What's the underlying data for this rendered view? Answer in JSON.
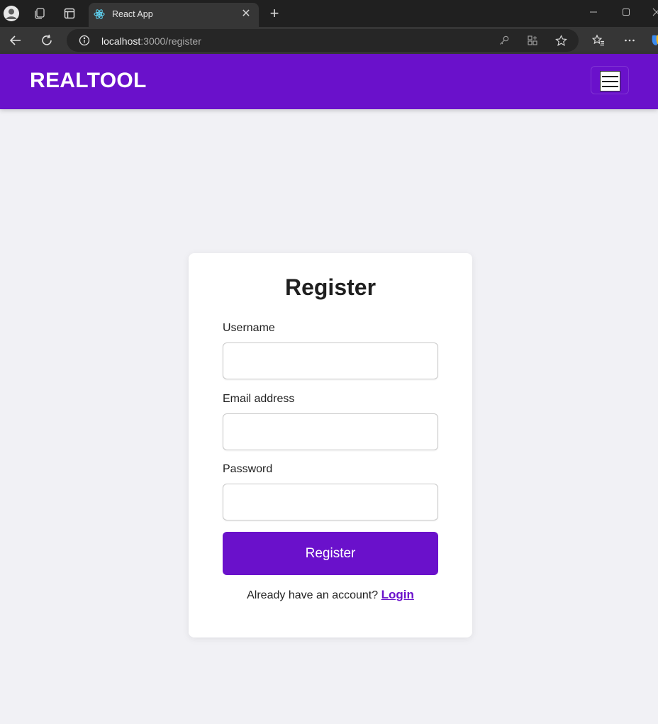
{
  "browser": {
    "tab_title": "React App",
    "tab_close_glyph": "✕",
    "new_tab_glyph": "+",
    "url_host": "localhost",
    "url_path": ":3000/register",
    "icons": [
      "profile-icon",
      "workspaces-icon",
      "tab-actions-icon",
      "react-favicon",
      "back-icon",
      "refresh-icon",
      "info-icon",
      "key-icon",
      "app-available-icon",
      "favorite-star-icon",
      "favorites-icon",
      "more-icon",
      "copilot-icon"
    ]
  },
  "header": {
    "brand": "REALTOOL",
    "menu_icon": "hamburger-menu-icon",
    "background": "#6a11cb"
  },
  "form": {
    "title": "Register",
    "username_label": "Username",
    "username_value": "",
    "email_label": "Email address",
    "email_value": "",
    "password_label": "Password",
    "password_value": "",
    "submit_label": "Register",
    "footer_text": "Already have an account?",
    "login_link": "Login",
    "accent": "#6a11cb"
  }
}
